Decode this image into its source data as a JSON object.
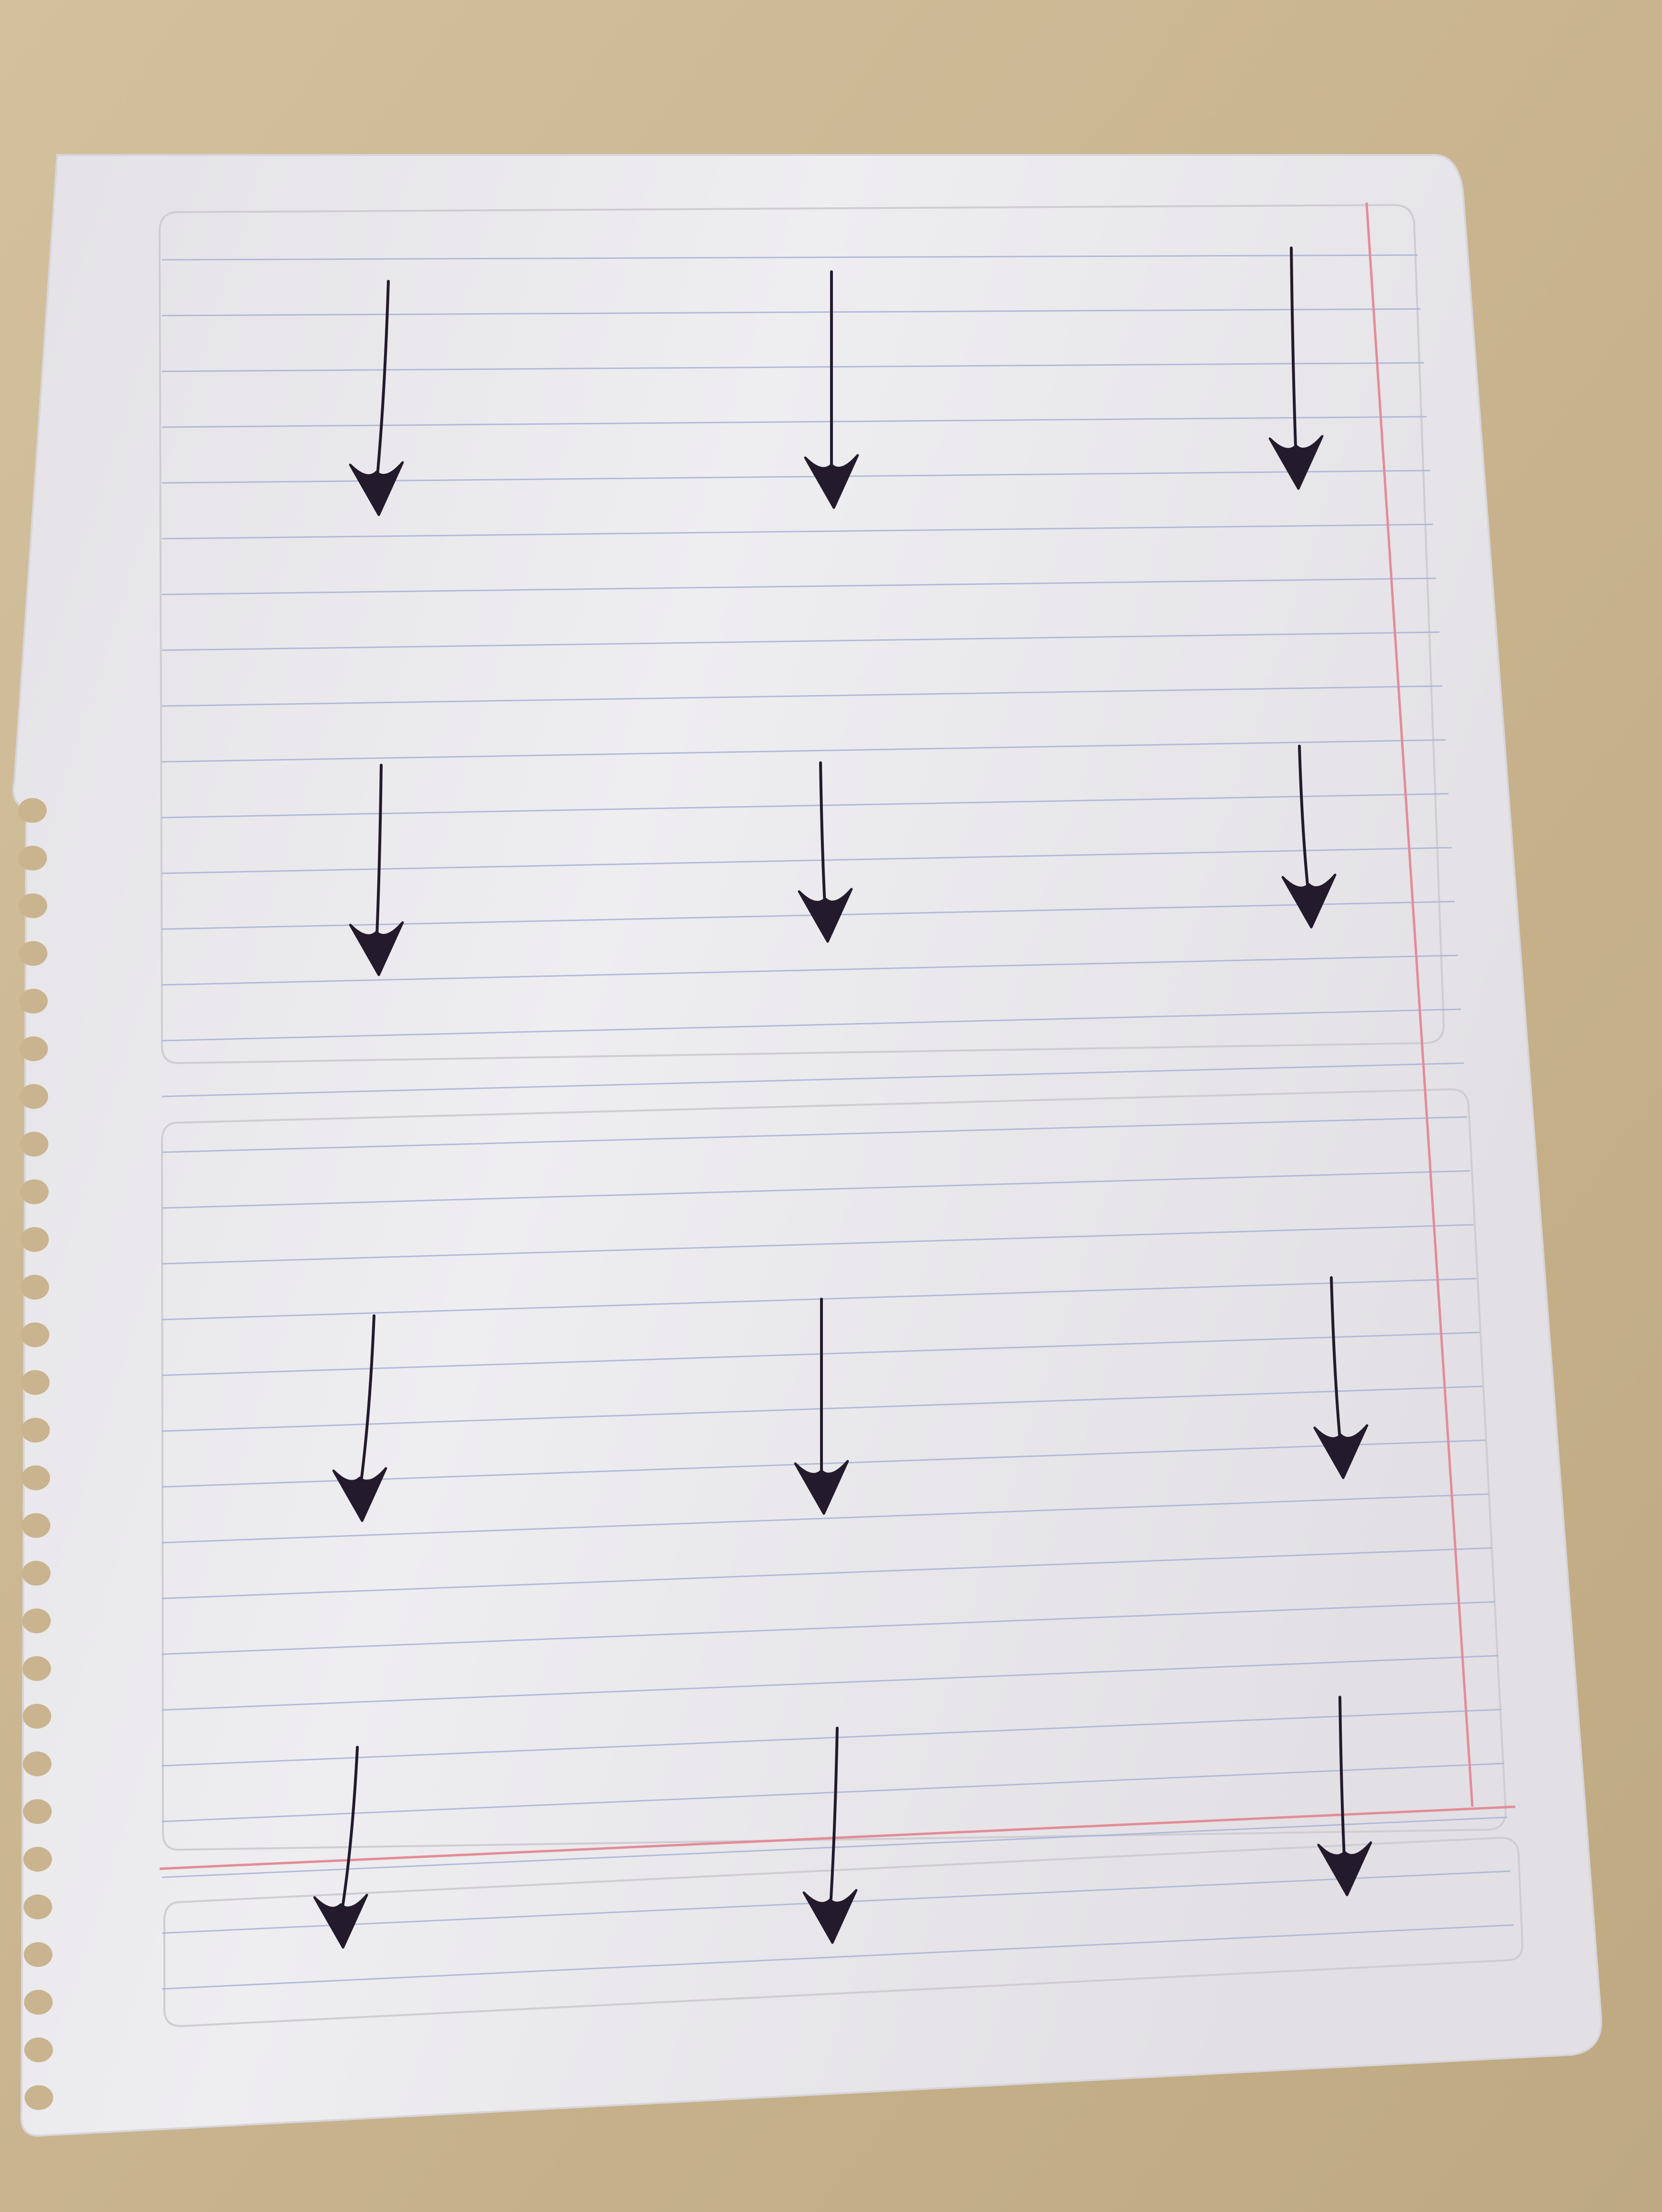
{
  "scene": {
    "description_free": true,
    "colors": {
      "desk": "#c9b48f",
      "desk_dark": "#b89f78",
      "paper": "#ebe9ec",
      "paper_shadow": "#d6d3d6",
      "rule_line": "#a9b2d8",
      "margin_line": "#e08a96",
      "border_line": "#cfcdd2",
      "ink": "#231a2c"
    },
    "arrow_rows": 4,
    "arrow_columns": 3,
    "arrows": [
      {
        "row": 1,
        "col": 1
      },
      {
        "row": 1,
        "col": 2
      },
      {
        "row": 1,
        "col": 3
      },
      {
        "row": 2,
        "col": 1
      },
      {
        "row": 2,
        "col": 2
      },
      {
        "row": 2,
        "col": 3
      },
      {
        "row": 3,
        "col": 1
      },
      {
        "row": 3,
        "col": 2
      },
      {
        "row": 3,
        "col": 3
      },
      {
        "row": 4,
        "col": 1
      },
      {
        "row": 4,
        "col": 2
      },
      {
        "row": 4,
        "col": 3
      }
    ],
    "arrow_direction": "down"
  }
}
